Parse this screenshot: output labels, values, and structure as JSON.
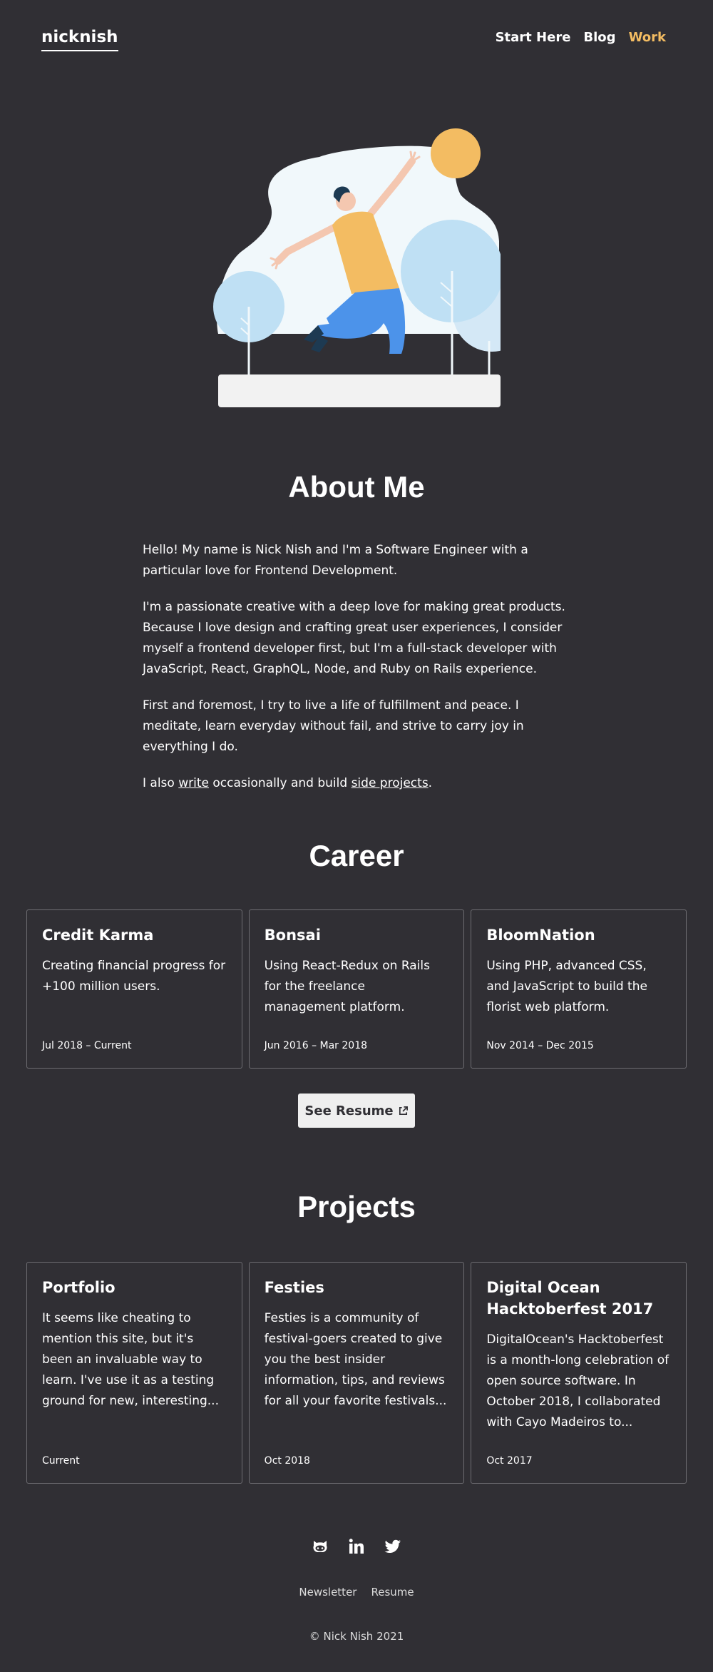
{
  "header": {
    "logo": "nicknish",
    "nav": [
      {
        "label": "Start Here",
        "active": false
      },
      {
        "label": "Blog",
        "active": false
      },
      {
        "label": "Work",
        "active": true
      }
    ],
    "accent_color": "#f3bc62"
  },
  "about": {
    "title": "About Me",
    "paragraphs": [
      "Hello! My name is Nick Nish and I'm a Software Engineer with a particular love for Frontend Development.",
      "I'm a passionate creative with a deep love for making great products. Because I love design and crafting great user experiences, I consider myself a frontend developer first, but I'm a full-stack developer with JavaScript, React, GraphQL, Node, and Ruby on Rails experience.",
      "First and foremost, I try to live a life of fulfillment and peace. I meditate, learn everyday without fail, and strive to carry joy in everything I do."
    ],
    "last_line": {
      "prefix": "I also ",
      "link1": "write",
      "middle": " occasionally and build ",
      "link2": "side projects",
      "suffix": "."
    }
  },
  "career": {
    "title": "Career",
    "cards": [
      {
        "title": "Credit Karma",
        "desc": "Creating financial progress for +100 million users.",
        "date": "Jul 2018 – Current"
      },
      {
        "title": "Bonsai",
        "desc": "Using React-Redux on Rails for the freelance management platform.",
        "date": "Jun 2016 – Mar 2018"
      },
      {
        "title": "BloomNation",
        "desc": "Using PHP, advanced CSS, and JavaScript to build the florist web platform.",
        "date": "Nov 2014 – Dec 2015"
      }
    ],
    "resume_button": "See Resume"
  },
  "projects": {
    "title": "Projects",
    "cards": [
      {
        "title": "Portfolio",
        "desc": "It seems like cheating to mention this site, but it's been an invaluable way to learn. I've use it as a testing ground for new, interesting...",
        "date": "Current"
      },
      {
        "title": "Festies",
        "desc": "Festies is a community of festival-goers created to give you the best insider information, tips, and reviews for all your favorite festivals...",
        "date": "Oct 2018"
      },
      {
        "title": "Digital Ocean Hacktoberfest 2017",
        "desc": "DigitalOcean's Hacktoberfest is a month-long celebration of open source software. In October 2018, I collaborated with Cayo Madeiros to...",
        "date": "Oct 2017"
      }
    ]
  },
  "footer": {
    "social_icons": [
      "github-icon",
      "linkedin-icon",
      "twitter-icon"
    ],
    "links": [
      "Newsletter",
      "Resume"
    ],
    "copyright": "© Nick Nish 2021"
  }
}
